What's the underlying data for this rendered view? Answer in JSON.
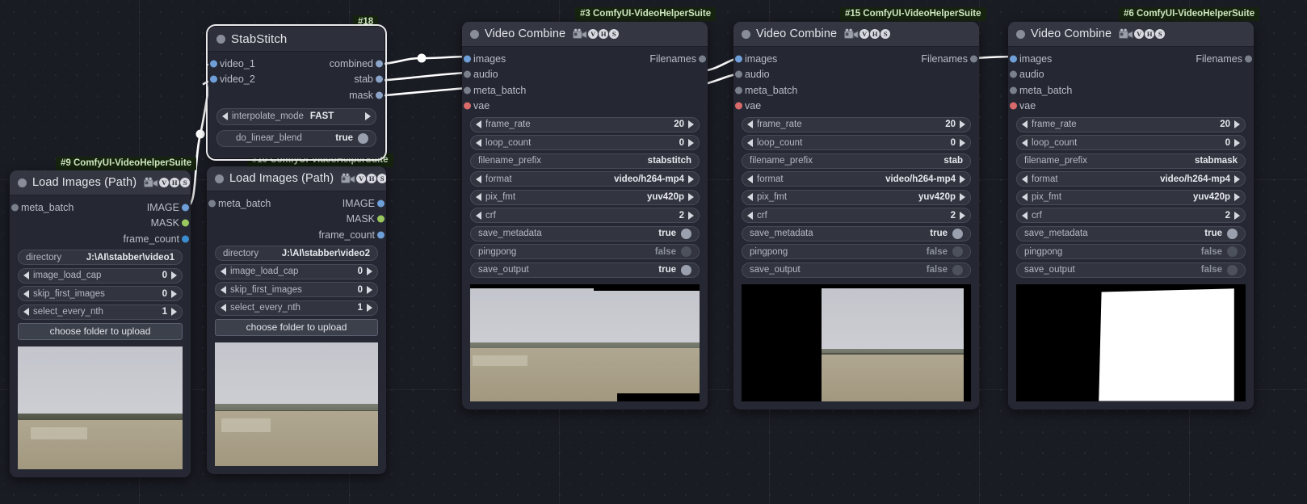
{
  "app": {
    "name": "ComfyUI node graph",
    "accent_image": "#6f9fd8",
    "accent_mask": "#9ac85f",
    "accent_vae": "#d96a6a",
    "badge_bg": "#16240f",
    "badge_fg": "#cfe8c0",
    "node_bg": "#252833",
    "node_title_bg": "#343742",
    "canvas_bg": "#1a1c24"
  },
  "badges": {
    "node9": "#9 ComfyUI-VideoHelperSuite",
    "node10": "#10 ComfyUI-VideoHelperSuite",
    "node18": "#18",
    "node3": "#3 ComfyUI-VideoHelperSuite",
    "node15": "#15 ComfyUI-VideoHelperSuite",
    "node6": "#6 ComfyUI-VideoHelperSuite"
  },
  "vhs_badges": [
    "V",
    "H",
    "S"
  ],
  "nodes": {
    "load_images_1": {
      "title": "Load Images (Path)",
      "inputs": [
        {
          "label": "meta_batch",
          "color": "gray"
        }
      ],
      "outputs": [
        {
          "label": "IMAGE",
          "color": "image"
        },
        {
          "label": "MASK",
          "color": "mask"
        },
        {
          "label": "frame_count",
          "color": "int"
        }
      ],
      "widgets": [
        {
          "type": "text",
          "name": "directory",
          "value": "J:\\AI\\stabber\\video1"
        },
        {
          "type": "number",
          "name": "image_load_cap",
          "value": "0"
        },
        {
          "type": "number",
          "name": "skip_first_images",
          "value": "0"
        },
        {
          "type": "number",
          "name": "select_every_nth",
          "value": "1"
        },
        {
          "type": "button",
          "name": "choose folder to upload"
        }
      ]
    },
    "load_images_2": {
      "title": "Load Images (Path)",
      "inputs": [
        {
          "label": "meta_batch",
          "color": "gray"
        }
      ],
      "outputs": [
        {
          "label": "IMAGE",
          "color": "image"
        },
        {
          "label": "MASK",
          "color": "mask"
        },
        {
          "label": "frame_count",
          "color": "int"
        }
      ],
      "widgets": [
        {
          "type": "text",
          "name": "directory",
          "value": "J:\\AI\\stabber\\video2"
        },
        {
          "type": "number",
          "name": "image_load_cap",
          "value": "0"
        },
        {
          "type": "number",
          "name": "skip_first_images",
          "value": "0"
        },
        {
          "type": "number",
          "name": "select_every_nth",
          "value": "1"
        },
        {
          "type": "button",
          "name": "choose folder to upload"
        }
      ]
    },
    "stabstitch": {
      "title": "StabStitch",
      "inputs": [
        {
          "label": "video_1",
          "color": "image"
        },
        {
          "label": "video_2",
          "color": "image"
        }
      ],
      "outputs": [
        {
          "label": "combined",
          "color": "vhs"
        },
        {
          "label": "stab",
          "color": "vhs"
        },
        {
          "label": "mask",
          "color": "vhs"
        }
      ],
      "widgets": [
        {
          "type": "combo",
          "name": "interpolate_mode",
          "value": "FAST"
        },
        {
          "type": "toggle",
          "name": "do_linear_blend",
          "value": "true",
          "on": true
        }
      ]
    },
    "video_combine_3": {
      "title": "Video Combine",
      "inputs": [
        {
          "label": "images",
          "color": "image"
        },
        {
          "label": "audio",
          "color": "gray"
        },
        {
          "label": "meta_batch",
          "color": "gray"
        },
        {
          "label": "vae",
          "color": "red"
        }
      ],
      "outputs": [
        {
          "label": "Filenames",
          "color": "gray"
        }
      ],
      "widgets": [
        {
          "type": "number",
          "name": "frame_rate",
          "value": "20"
        },
        {
          "type": "number",
          "name": "loop_count",
          "value": "0"
        },
        {
          "type": "text",
          "name": "filename_prefix",
          "value": "stabstitch"
        },
        {
          "type": "combo",
          "name": "format",
          "value": "video/h264-mp4"
        },
        {
          "type": "combo",
          "name": "pix_fmt",
          "value": "yuv420p"
        },
        {
          "type": "number",
          "name": "crf",
          "value": "2"
        },
        {
          "type": "toggle",
          "name": "save_metadata",
          "value": "true",
          "on": true
        },
        {
          "type": "toggle",
          "name": "pingpong",
          "value": "false",
          "on": false
        },
        {
          "type": "toggle",
          "name": "save_output",
          "value": "true",
          "on": true
        }
      ],
      "preview": "stitched-landscape-frame"
    },
    "video_combine_15": {
      "title": "Video Combine",
      "inputs": [
        {
          "label": "images",
          "color": "image"
        },
        {
          "label": "audio",
          "color": "gray"
        },
        {
          "label": "meta_batch",
          "color": "gray"
        },
        {
          "label": "vae",
          "color": "red"
        }
      ],
      "outputs": [
        {
          "label": "Filenames",
          "color": "gray"
        }
      ],
      "widgets": [
        {
          "type": "number",
          "name": "frame_rate",
          "value": "20"
        },
        {
          "type": "number",
          "name": "loop_count",
          "value": "0"
        },
        {
          "type": "text",
          "name": "filename_prefix",
          "value": "stab"
        },
        {
          "type": "combo",
          "name": "format",
          "value": "video/h264-mp4"
        },
        {
          "type": "combo",
          "name": "pix_fmt",
          "value": "yuv420p"
        },
        {
          "type": "number",
          "name": "crf",
          "value": "2"
        },
        {
          "type": "toggle",
          "name": "save_metadata",
          "value": "true",
          "on": true
        },
        {
          "type": "toggle",
          "name": "pingpong",
          "value": "false",
          "on": false
        },
        {
          "type": "toggle",
          "name": "save_output",
          "value": "false",
          "on": false
        }
      ],
      "preview": "stabilized-landscape-frame"
    },
    "video_combine_6": {
      "title": "Video Combine",
      "inputs": [
        {
          "label": "images",
          "color": "image"
        },
        {
          "label": "audio",
          "color": "gray"
        },
        {
          "label": "meta_batch",
          "color": "gray"
        },
        {
          "label": "vae",
          "color": "red"
        }
      ],
      "outputs": [
        {
          "label": "Filenames",
          "color": "gray"
        }
      ],
      "widgets": [
        {
          "type": "number",
          "name": "frame_rate",
          "value": "20"
        },
        {
          "type": "number",
          "name": "loop_count",
          "value": "0"
        },
        {
          "type": "text",
          "name": "filename_prefix",
          "value": "stabmask"
        },
        {
          "type": "combo",
          "name": "format",
          "value": "video/h264-mp4"
        },
        {
          "type": "combo",
          "name": "pix_fmt",
          "value": "yuv420p"
        },
        {
          "type": "number",
          "name": "crf",
          "value": "2"
        },
        {
          "type": "toggle",
          "name": "save_metadata",
          "value": "true",
          "on": true
        },
        {
          "type": "toggle",
          "name": "pingpong",
          "value": "false",
          "on": false
        },
        {
          "type": "toggle",
          "name": "save_output",
          "value": "false",
          "on": false
        }
      ],
      "preview": "white-mask-frame"
    }
  }
}
